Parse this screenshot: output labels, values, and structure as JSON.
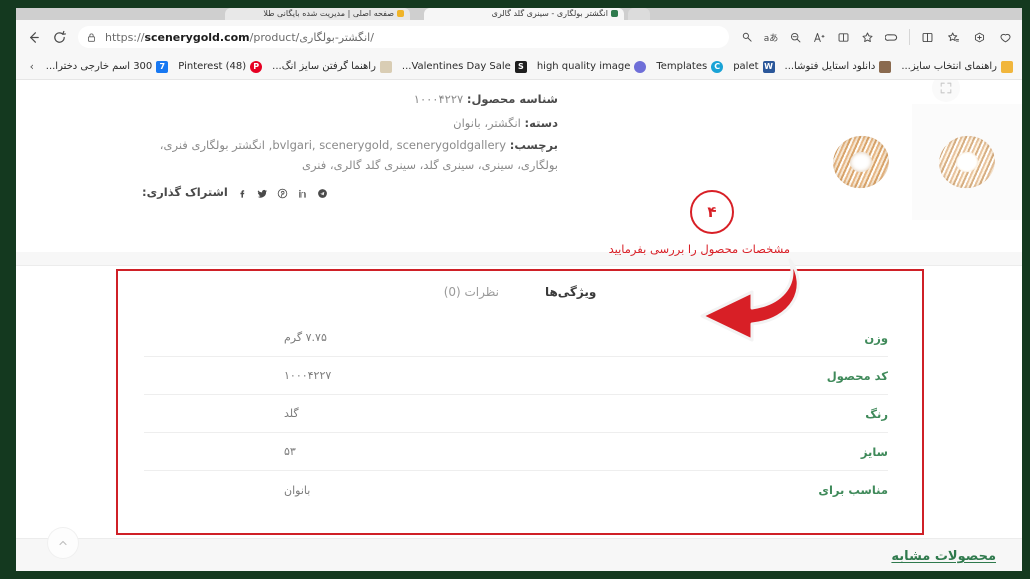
{
  "browser": {
    "tabs": [
      {
        "title": "صفحه اصلی | مدیریت شده بایگانی طلا"
      },
      {
        "title": "انگشتر بولگاری - سینری گلد گالری"
      },
      {
        "title": ""
      }
    ],
    "nav": {
      "back_label": "Back",
      "reload_label": "Refresh"
    },
    "omnibox": {
      "lock_label": "Site information",
      "url_prefix": "https://",
      "url_domain": "scenerygold.com",
      "url_path": "/product/انگشتر-بولگاری/"
    },
    "toolbar_icons": [
      "read-aloud-icon",
      "translate-icon",
      "zoom-out-icon",
      "font-size-icon",
      "immersive-reader-icon",
      "favorite-star-icon",
      "copilot-icon",
      "split-screen-icon",
      "collections-icon",
      "browser-essentials-icon",
      "extensions-icon"
    ],
    "bookmarks": [
      {
        "label": "راهنمای انتخاب سایز...",
        "color": "#f1b63c"
      },
      {
        "label": "دانلود استایل فتوشا...",
        "color": "#8a6a4f"
      },
      {
        "label": "palet",
        "color": "#2b579a",
        "glyph": "W"
      },
      {
        "label": "Templates",
        "color": "#1aa3d6",
        "glyph": "C"
      },
      {
        "label": "high quality image",
        "color": "#6f6fd8",
        "glyph": ""
      },
      {
        "label": "Valentines Day Sale...",
        "color": "#1f1f1f",
        "glyph": "S"
      },
      {
        "label": "راهنما گرفتن سایز انگ...",
        "color": "#d9cdb4"
      },
      {
        "label": "Pinterest (48)",
        "color": "#e60023",
        "glyph": "P"
      },
      {
        "label": "300 اسم خارجی دخترا...",
        "color": "#1778f2",
        "glyph": "7"
      }
    ],
    "bookmark_overflow": "›"
  },
  "product_meta": {
    "sku_label": "شناسه محصول:",
    "sku_value": "۱۰۰۰۴۲۲۷",
    "category_label": "دسته:",
    "category_value": "انگشتر، بانوان",
    "tags_label": "برچسب:",
    "tags_value": "bvlgari, scenerygold, scenerygoldgallery, انگشتر بولگاری فنری، بولگاری، سینری، سینری گلد، سینری گلد گالری، فنری",
    "share_label": "اشتراک گذاری:",
    "share_icons": [
      "telegram-icon",
      "linkedin-icon",
      "pinterest-icon",
      "twitter-icon",
      "facebook-icon"
    ]
  },
  "gallery": {
    "zoom_icon": "zoom-expand-icon",
    "thumbnails": [
      {
        "alt": "انگشتر بولگاری طلایی - نمای اول"
      },
      {
        "alt": "انگشتر بولگاری طلایی - نمای دوم"
      }
    ]
  },
  "annotation": {
    "step_number": "۴",
    "text": "مشخصات محصول را بررسی بفرمایید",
    "color": "#d81f26"
  },
  "detail_tabs": [
    {
      "label": "ویژگی‌ها",
      "active": true
    },
    {
      "label": "نظرات (0)",
      "active": false
    }
  ],
  "specs": {
    "rows": [
      {
        "key": "وزن",
        "value": "۷.۷۵ گرم"
      },
      {
        "key": "کد محصول",
        "value": "۱۰۰۰۴۲۲۷"
      },
      {
        "key": "رنگ",
        "value": "گلد"
      },
      {
        "key": "سایز",
        "value": "۵۳"
      },
      {
        "key": "مناسب برای",
        "value": "بانوان"
      }
    ]
  },
  "footer": {
    "similar_heading": "محصولات مشابه",
    "scroll_top_label": "بازگشت به بالا"
  },
  "colors": {
    "frame_green": "#14391f",
    "annotation_red": "#d81f26",
    "box_red": "#cf2027",
    "spec_key_green": "#3f8a5a",
    "heading_green": "#2f7a4d"
  }
}
